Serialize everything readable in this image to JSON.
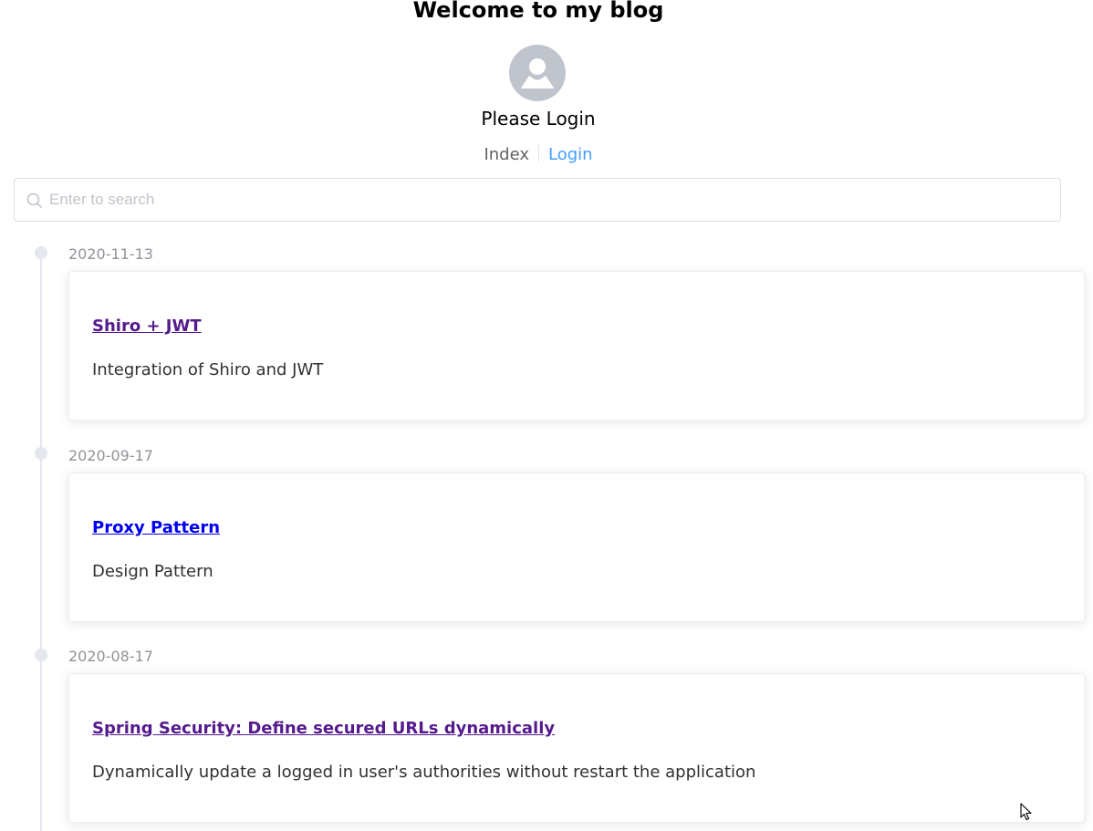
{
  "header": {
    "title": "Welcome to my blog",
    "login_prompt": "Please Login"
  },
  "nav": {
    "index_label": "Index",
    "login_label": "Login"
  },
  "search": {
    "placeholder": "Enter to search",
    "value": ""
  },
  "posts": [
    {
      "date": "2020-11-13",
      "title": "Shiro + JWT",
      "description": "Integration of Shiro and JWT",
      "visited": true
    },
    {
      "date": "2020-09-17",
      "title": "Proxy Pattern",
      "description": "Design Pattern",
      "visited": false
    },
    {
      "date": "2020-08-17",
      "title": "Spring Security: Define secured URLs dynamically",
      "description": "Dynamically update a logged in user's authorities without restart the application",
      "visited": true
    }
  ],
  "colors": {
    "accent": "#409eff",
    "visited_link": "#551a8b",
    "unvisited_link": "#0000ee",
    "avatar_bg": "#c0c4cc",
    "timeline": "#e4e7ed"
  },
  "icons": {
    "avatar": "user-icon",
    "search": "search-icon"
  }
}
